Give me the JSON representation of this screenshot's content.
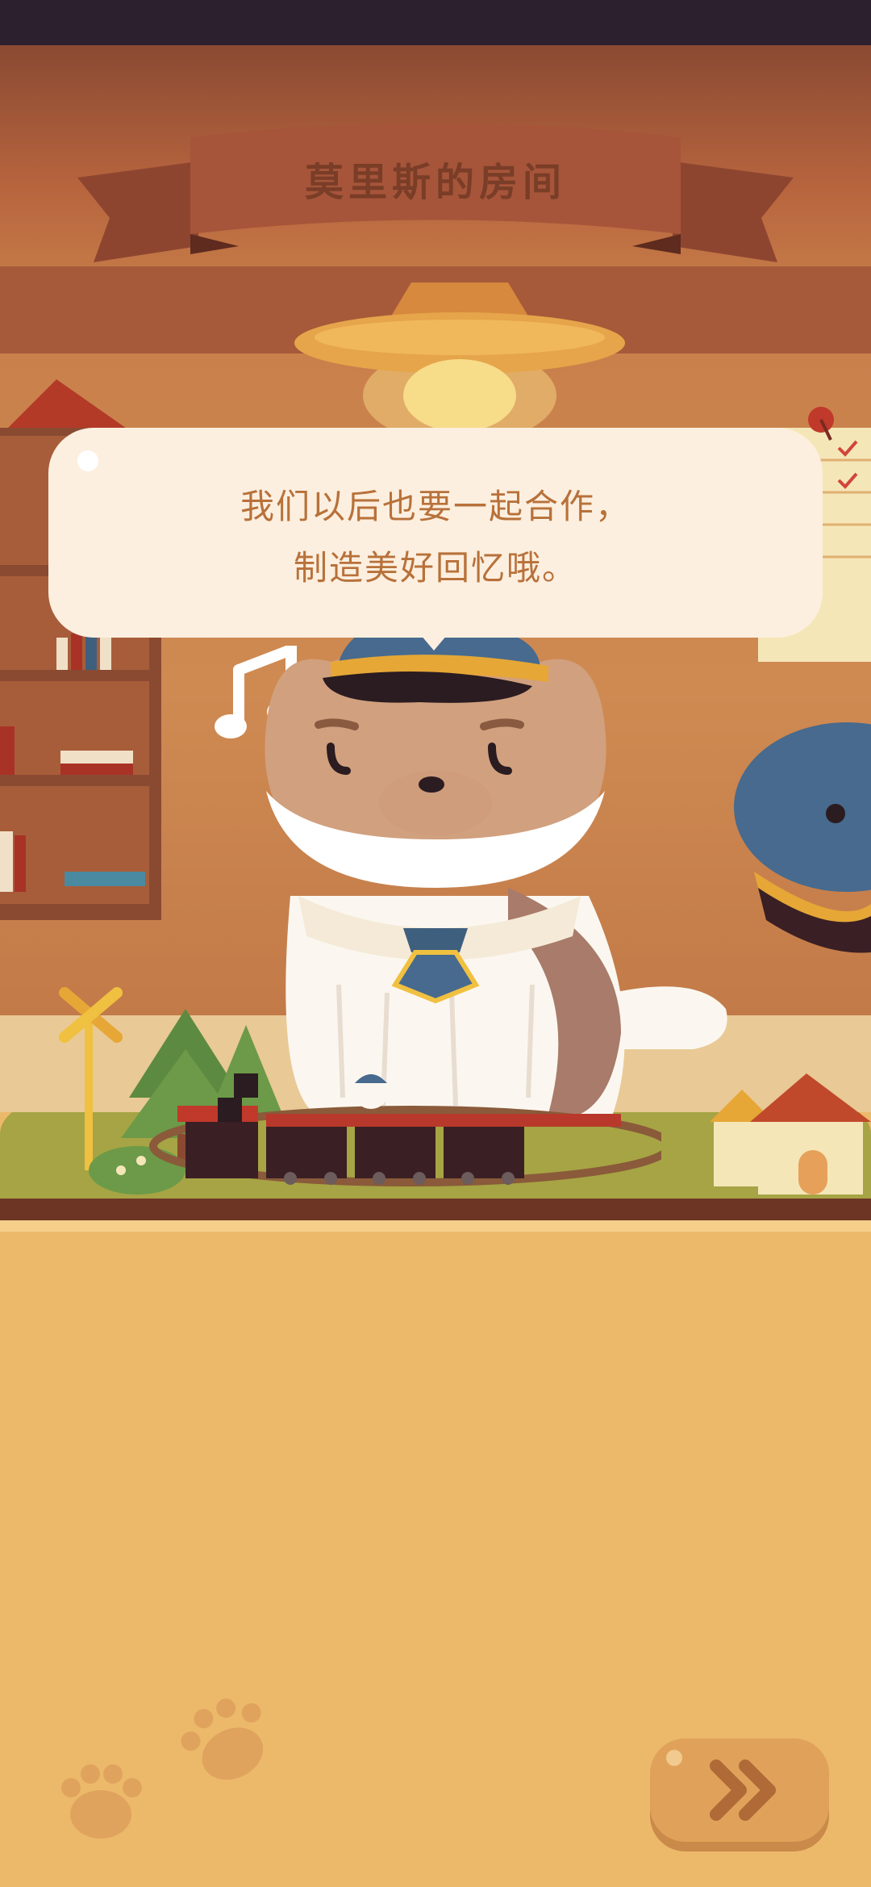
{
  "room": {
    "title": "莫里斯的房间"
  },
  "dialogue": {
    "line1": "我们以后也要一起合作，",
    "line2": "制造美好回忆哦。"
  },
  "controls": {
    "next_icon": "double-chevron-right-icon"
  },
  "colors": {
    "panel": "#ecb96a",
    "banner": "#a6553a",
    "speech_bubble": "#fcefdf",
    "dialogue_text": "#b8713a",
    "next_button": "#e0a25a"
  }
}
